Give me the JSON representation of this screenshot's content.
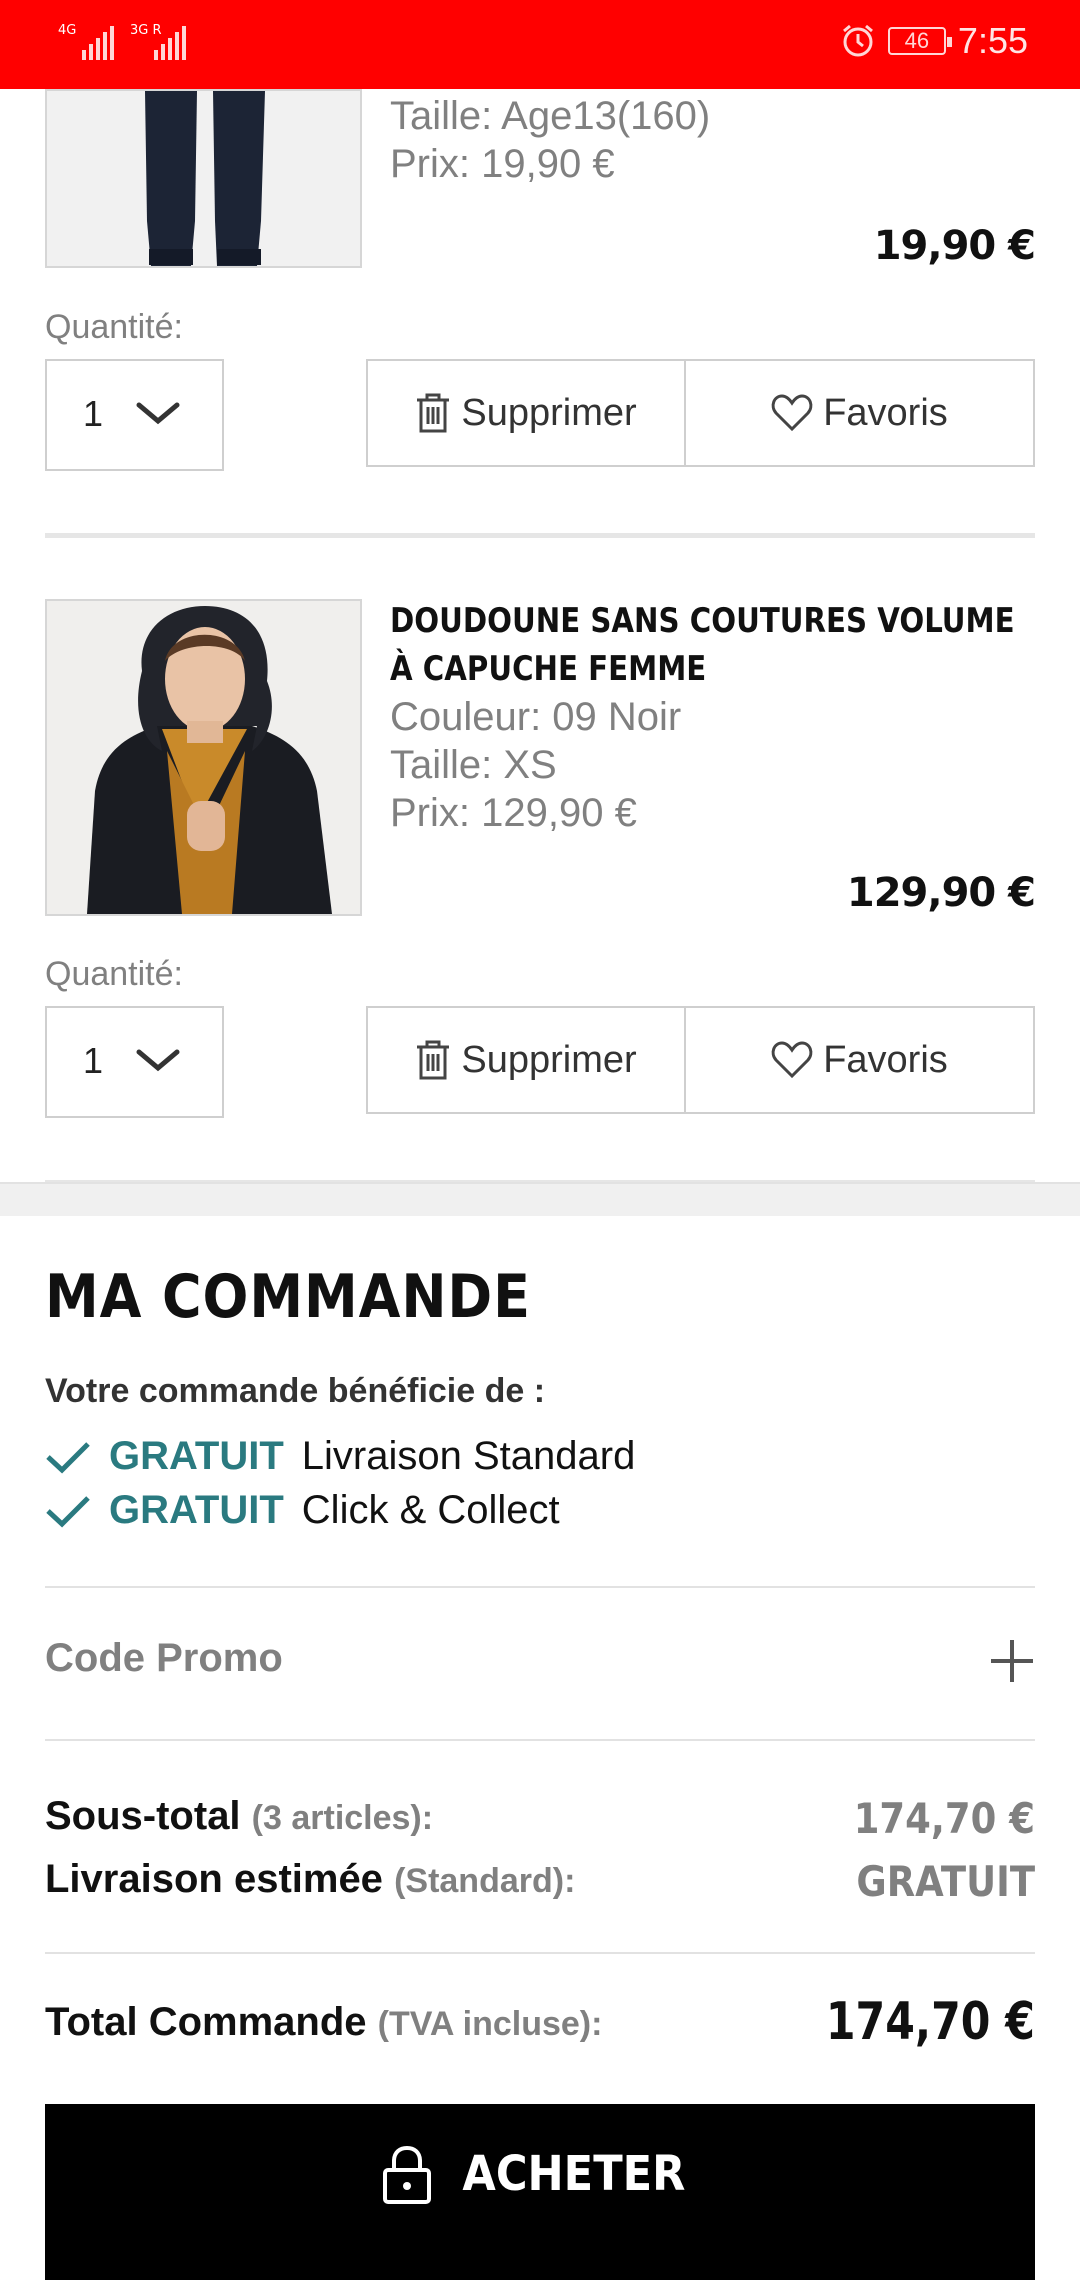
{
  "status_bar": {
    "network_1": "4G",
    "network_2": "3G R",
    "battery": "46",
    "time": "7:55",
    "icons": [
      "signal-icon",
      "signal-icon",
      "alarm-icon",
      "battery-icon"
    ]
  },
  "items": [
    {
      "image": "navy-jogger-pants",
      "size": "Taille: Age13(160)",
      "unit_price": "Prix: 19,90  €",
      "price": "19,90 €",
      "quantity_label": "Quantité:",
      "quantity": "1",
      "delete_label": "Supprimer",
      "favorite_label": "Favoris"
    },
    {
      "image": "woman-black-puffer-jacket",
      "title_line1": "DOUDOUNE SANS COUTURES VOLUME",
      "title_line2": "À CAPUCHE FEMME",
      "color": "Couleur: 09 Noir",
      "size": "Taille: XS",
      "unit_price": "Prix: 129,90  €",
      "price": "129,90 €",
      "quantity_label": "Quantité:",
      "quantity": "1",
      "delete_label": "Supprimer",
      "favorite_label": "Favoris"
    }
  ],
  "order": {
    "title": "MA COMMANDE",
    "benefit_intro": "Votre commande bénéficie de :",
    "benefits": [
      {
        "free": "GRATUIT",
        "text": "Livraison Standard"
      },
      {
        "free": "GRATUIT",
        "text": "Click & Collect"
      }
    ],
    "promo_label": "Code Promo",
    "subtotal_label": "Sous-total",
    "subtotal_note": "(3 articles):",
    "subtotal_value": "174,70 €",
    "shipping_label": "Livraison estimée",
    "shipping_note": "(Standard):",
    "shipping_value": "GRATUIT",
    "total_label": "Total Commande",
    "total_note": "(TVA incluse):",
    "total_value": "174,70 €",
    "buy_label": "ACHETER"
  },
  "colors": {
    "status_bar": "#ff0000",
    "free_accent": "#2a7a80",
    "buy_button": "#000000"
  }
}
